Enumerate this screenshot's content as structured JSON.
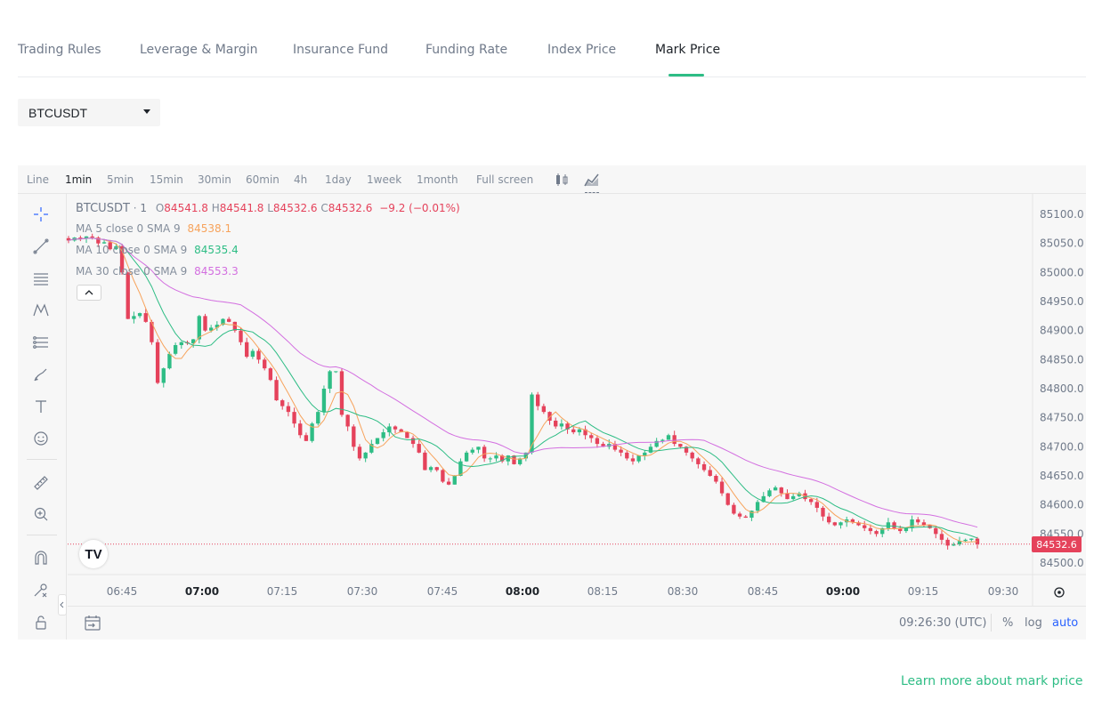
{
  "tabs": [
    {
      "label": "Trading Rules",
      "active": false
    },
    {
      "label": "Leverage & Margin",
      "active": false
    },
    {
      "label": "Insurance Fund",
      "active": false
    },
    {
      "label": "Funding Rate",
      "active": false
    },
    {
      "label": "Index Price",
      "active": false
    },
    {
      "label": "Mark Price",
      "active": true
    }
  ],
  "symbol_select": {
    "value": "BTCUSDT"
  },
  "toolbar": {
    "timeframes": [
      "Line",
      "1min",
      "5min",
      "15min",
      "30min",
      "60min",
      "4h",
      "1day",
      "1week",
      "1month",
      "Full screen"
    ],
    "active_timeframe": "1min",
    "icons": [
      "candle-style-icon",
      "indicators-icon"
    ]
  },
  "left_tools": [
    "crosshair-icon",
    "trend-line-icon",
    "horizontal-lines-icon",
    "pattern-icon",
    "fib-retracement-icon",
    "brush-icon",
    "text-icon",
    "emoji-icon",
    "ruler-icon",
    "zoom-in-icon",
    "magnet-icon",
    "lock-drawing-icon",
    "unlock-icon"
  ],
  "legend": {
    "symbol": "BTCUSDT",
    "interval": "1",
    "o_label": "O",
    "o": "84541.8",
    "h_label": "H",
    "h": "84541.8",
    "l_label": "L",
    "l": "84532.6",
    "c_label": "C",
    "c": "84532.6",
    "change": "−9.2 (−0.01%)",
    "ma": [
      {
        "label": "MA 5 close 0 SMA 9",
        "value": "84538.1",
        "color": "#f7a35c"
      },
      {
        "label": "MA 10 close 0 SMA 9",
        "value": "84535.4",
        "color": "#2ebd85"
      },
      {
        "label": "MA 30 close 0 SMA 9",
        "value": "84553.3",
        "color": "#d36fe0"
      }
    ]
  },
  "colors": {
    "up": "#2ebd85",
    "down": "#e5425b",
    "accent": "#2ebd85",
    "link_blue": "#2962ff"
  },
  "tv_logo": "TV",
  "last_price_tag": "84532.6",
  "bottom": {
    "time": "09:26:30 (UTC)",
    "percent": "%",
    "log": "log",
    "auto": "auto"
  },
  "learn_more": "Learn more about mark price",
  "chart_data": {
    "type": "candlestick",
    "interval": "1min",
    "y_ticks": [
      "85100.0",
      "85050.0",
      "85000.0",
      "84950.0",
      "84900.0",
      "84850.0",
      "84800.0",
      "84750.0",
      "84700.0",
      "84650.0",
      "84600.0",
      "84550.0",
      "84500.0"
    ],
    "x_ticks": [
      "06:45",
      "07:00",
      "07:15",
      "07:30",
      "07:45",
      "08:00",
      "08:15",
      "08:30",
      "08:45",
      "09:00",
      "09:15",
      "09:30"
    ],
    "ylim": [
      84480,
      85120
    ],
    "last_price": 84532.6,
    "closes": [
      85055,
      85060,
      85058,
      85062,
      85060,
      85050,
      85052,
      85040,
      85045,
      85000,
      84920,
      84925,
      84930,
      84915,
      84880,
      84810,
      84835,
      84860,
      84875,
      84880,
      84878,
      84885,
      84925,
      84900,
      84905,
      84910,
      84920,
      84915,
      84900,
      84880,
      84855,
      84865,
      84850,
      84835,
      84815,
      84780,
      84770,
      84760,
      84740,
      84720,
      84710,
      84740,
      84760,
      84800,
      84830,
      84830,
      84755,
      84735,
      84700,
      84680,
      84690,
      84705,
      84715,
      84725,
      84735,
      84730,
      84725,
      84715,
      84705,
      84690,
      84660,
      84665,
      84660,
      84640,
      84635,
      84650,
      84675,
      84690,
      84695,
      84700,
      84680,
      84680,
      84685,
      84675,
      84685,
      84670,
      84680,
      84690,
      84790,
      84770,
      84760,
      84745,
      84735,
      84740,
      84730,
      84725,
      84730,
      84720,
      84715,
      84705,
      84700,
      84705,
      84695,
      84690,
      84680,
      84675,
      84685,
      84690,
      84700,
      84710,
      84712,
      84720,
      84705,
      84700,
      84690,
      84680,
      84670,
      84660,
      84650,
      84640,
      84620,
      84600,
      84585,
      84580,
      84578,
      84590,
      84605,
      84615,
      84625,
      84630,
      84620,
      84610,
      84615,
      84620,
      84610,
      84605,
      84595,
      84580,
      84570,
      84565,
      84570,
      84575,
      84570,
      84565,
      84560,
      84555,
      84550,
      84560,
      84570,
      84560,
      84555,
      84560,
      84575,
      84570,
      84565,
      84560,
      84550,
      84540,
      84530,
      84532,
      84538,
      84540,
      84542,
      84532.6
    ],
    "ma_series": [
      "MA 5",
      "MA 10",
      "MA 30"
    ]
  }
}
